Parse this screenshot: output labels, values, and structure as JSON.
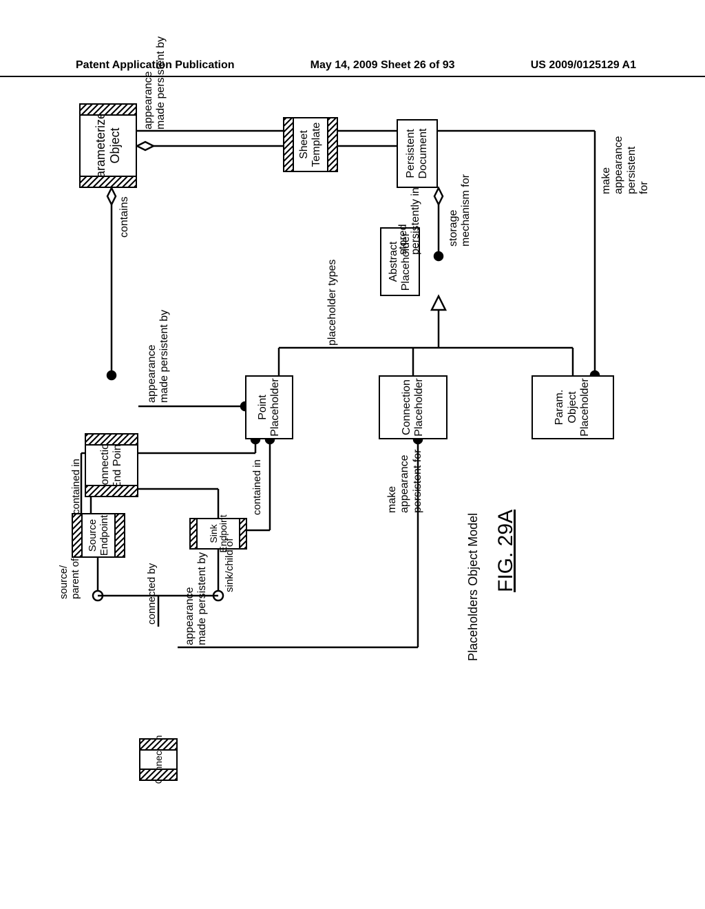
{
  "header": {
    "left": "Patent Application Publication",
    "center": "May 14, 2009  Sheet 26 of 93",
    "right": "US 2009/0125129 A1"
  },
  "figure": {
    "number": "FIG. 29A",
    "title": "Placeholders Object Model"
  },
  "boxes": {
    "parameterized_object": "Parameterized\nObject",
    "sheet_template": "Sheet Template",
    "persistent_document": "Persistent Document",
    "abstract_placeholder": "Abstract Placeholder",
    "connection_end_point": "Connection\nEnd Point",
    "point_placeholder": "Point\nPlaceholder",
    "connection_placeholder": "Connection\nPlaceholder",
    "param_object_placeholder": "Param. Object\nPlaceholder",
    "source_endpoint": "Source\nEndpoint",
    "sink_endpoint": "Sink Endpoint",
    "connection": "Connection"
  },
  "labels": {
    "appearance_made_persistent_by": "appearance\nmade persistent by",
    "storage_mechanism_for": "storage\nmechanism for",
    "stored_persistently_in": "stored\npersistently in",
    "placeholder_types": "placeholder types",
    "contains": "contains",
    "contained_in": "contained in",
    "make_appearance_persistent_for": "make\nappearance\npersistent\nfor",
    "make_appearance_persistent_for_conn": "make\nappearance\npersistent for",
    "sink_child_of": "sink/child of",
    "source_parent_of": "source/\nparent of",
    "connected_by": "connected by"
  }
}
